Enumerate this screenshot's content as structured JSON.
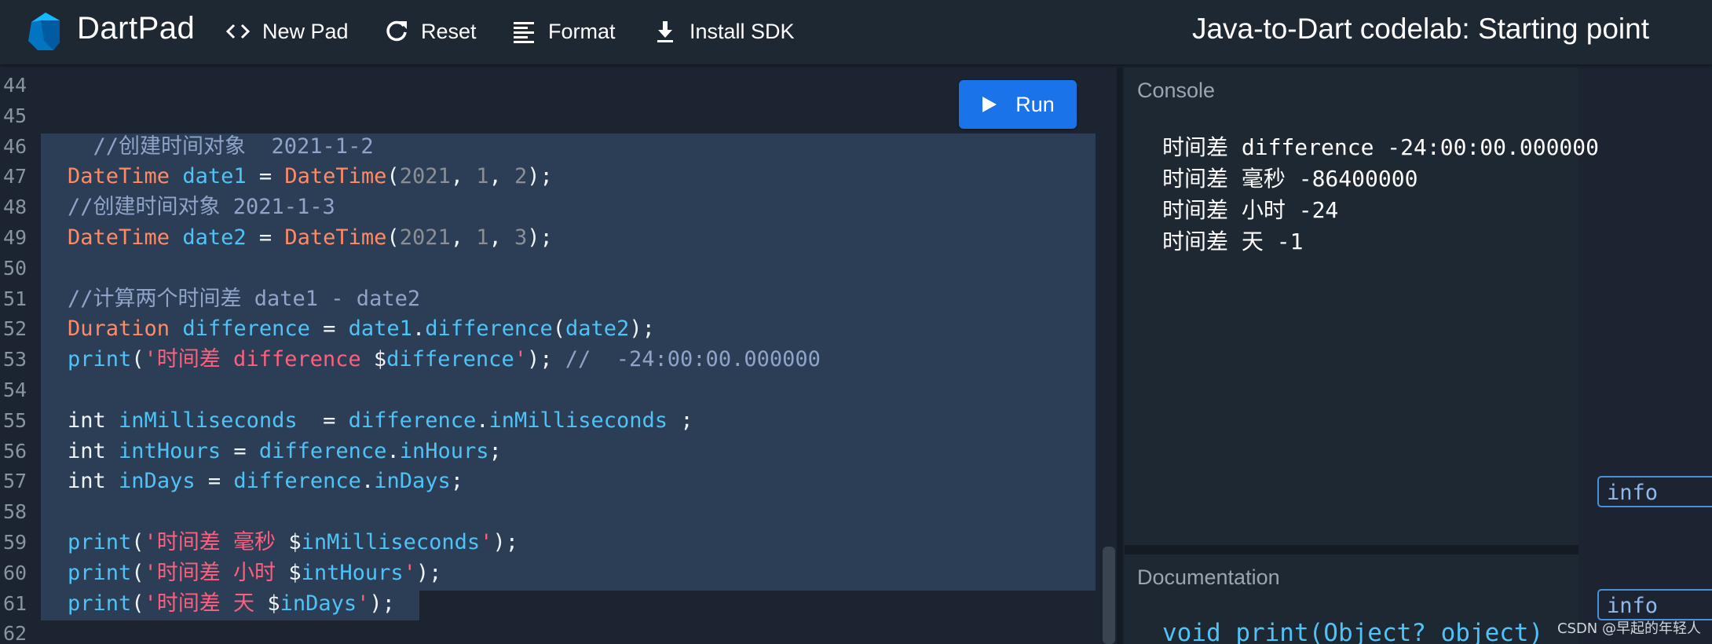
{
  "header": {
    "app_name": "DartPad",
    "new_pad_label": "New Pad",
    "reset_label": "Reset",
    "format_label": "Format",
    "install_sdk_label": "Install SDK",
    "doc_title": "Java-to-Dart codelab: Starting point"
  },
  "editor": {
    "run_label": "Run",
    "line_numbers": [
      "44",
      "45",
      "46",
      "47",
      "48",
      "49",
      "50",
      "51",
      "52",
      "53",
      "54",
      "55",
      "56",
      "57",
      "58",
      "59",
      "60",
      "61",
      "62"
    ],
    "lines": [
      [],
      [],
      [
        {
          "t": "com",
          "v": "  //创建时间对象  2021-1-2"
        }
      ],
      [
        {
          "t": "type",
          "v": "DateTime"
        },
        {
          "t": "plain",
          "v": " "
        },
        {
          "t": "var",
          "v": "date1"
        },
        {
          "t": "plain",
          "v": " = "
        },
        {
          "t": "type",
          "v": "DateTime"
        },
        {
          "t": "plain",
          "v": "("
        },
        {
          "t": "num",
          "v": "2021"
        },
        {
          "t": "plain",
          "v": ", "
        },
        {
          "t": "num",
          "v": "1"
        },
        {
          "t": "plain",
          "v": ", "
        },
        {
          "t": "num",
          "v": "2"
        },
        {
          "t": "plain",
          "v": ");"
        }
      ],
      [
        {
          "t": "com",
          "v": "//创建时间对象 2021-1-3"
        }
      ],
      [
        {
          "t": "type",
          "v": "DateTime"
        },
        {
          "t": "plain",
          "v": " "
        },
        {
          "t": "var",
          "v": "date2"
        },
        {
          "t": "plain",
          "v": " = "
        },
        {
          "t": "type",
          "v": "DateTime"
        },
        {
          "t": "plain",
          "v": "("
        },
        {
          "t": "num",
          "v": "2021"
        },
        {
          "t": "plain",
          "v": ", "
        },
        {
          "t": "num",
          "v": "1"
        },
        {
          "t": "plain",
          "v": ", "
        },
        {
          "t": "num",
          "v": "3"
        },
        {
          "t": "plain",
          "v": ");"
        }
      ],
      [],
      [
        {
          "t": "com",
          "v": "//计算两个时间差 date1 - date2"
        }
      ],
      [
        {
          "t": "type",
          "v": "Duration"
        },
        {
          "t": "plain",
          "v": " "
        },
        {
          "t": "var",
          "v": "difference"
        },
        {
          "t": "plain",
          "v": " = "
        },
        {
          "t": "var",
          "v": "date1"
        },
        {
          "t": "plain",
          "v": "."
        },
        {
          "t": "fn",
          "v": "difference"
        },
        {
          "t": "plain",
          "v": "("
        },
        {
          "t": "var",
          "v": "date2"
        },
        {
          "t": "plain",
          "v": ");"
        }
      ],
      [
        {
          "t": "fn",
          "v": "print"
        },
        {
          "t": "plain",
          "v": "("
        },
        {
          "t": "str",
          "v": "'时间差 difference "
        },
        {
          "t": "plain",
          "v": "$"
        },
        {
          "t": "var",
          "v": "difference"
        },
        {
          "t": "str",
          "v": "'"
        },
        {
          "t": "plain",
          "v": "); "
        },
        {
          "t": "com",
          "v": "//  -24:00:00.000000"
        }
      ],
      [],
      [
        {
          "t": "kw",
          "v": "int"
        },
        {
          "t": "plain",
          "v": " "
        },
        {
          "t": "var",
          "v": "inMilliseconds"
        },
        {
          "t": "plain",
          "v": "  = "
        },
        {
          "t": "var",
          "v": "difference"
        },
        {
          "t": "plain",
          "v": "."
        },
        {
          "t": "var",
          "v": "inMilliseconds"
        },
        {
          "t": "plain",
          "v": " ;"
        }
      ],
      [
        {
          "t": "kw",
          "v": "int"
        },
        {
          "t": "plain",
          "v": " "
        },
        {
          "t": "var",
          "v": "intHours"
        },
        {
          "t": "plain",
          "v": " = "
        },
        {
          "t": "var",
          "v": "difference"
        },
        {
          "t": "plain",
          "v": "."
        },
        {
          "t": "var",
          "v": "inHours"
        },
        {
          "t": "plain",
          "v": ";"
        }
      ],
      [
        {
          "t": "kw",
          "v": "int"
        },
        {
          "t": "plain",
          "v": " "
        },
        {
          "t": "var",
          "v": "inDays"
        },
        {
          "t": "plain",
          "v": " = "
        },
        {
          "t": "var",
          "v": "difference"
        },
        {
          "t": "plain",
          "v": "."
        },
        {
          "t": "var",
          "v": "inDays"
        },
        {
          "t": "plain",
          "v": ";"
        }
      ],
      [],
      [
        {
          "t": "fn",
          "v": "print"
        },
        {
          "t": "plain",
          "v": "("
        },
        {
          "t": "str",
          "v": "'时间差 毫秒 "
        },
        {
          "t": "plain",
          "v": "$"
        },
        {
          "t": "var",
          "v": "inMilliseconds"
        },
        {
          "t": "str",
          "v": "'"
        },
        {
          "t": "plain",
          "v": ");"
        }
      ],
      [
        {
          "t": "fn",
          "v": "print"
        },
        {
          "t": "plain",
          "v": "("
        },
        {
          "t": "str",
          "v": "'时间差 小时 "
        },
        {
          "t": "plain",
          "v": "$"
        },
        {
          "t": "var",
          "v": "intHours"
        },
        {
          "t": "str",
          "v": "'"
        },
        {
          "t": "plain",
          "v": ");"
        }
      ],
      [
        {
          "t": "fn",
          "v": "print"
        },
        {
          "t": "plain",
          "v": "("
        },
        {
          "t": "str",
          "v": "'时间差 天 "
        },
        {
          "t": "plain",
          "v": "$"
        },
        {
          "t": "var",
          "v": "inDays"
        },
        {
          "t": "str",
          "v": "'"
        },
        {
          "t": "plain",
          "v": ");"
        }
      ],
      []
    ]
  },
  "console": {
    "title": "Console",
    "lines": [
      "时间差 difference -24:00:00.000000",
      "时间差 毫秒 -86400000",
      "时间差 小时 -24",
      "时间差 天 -1"
    ]
  },
  "documentation": {
    "title": "Documentation",
    "signature": "void print(Object? object)"
  },
  "issues": {
    "badges": [
      "info",
      "info"
    ]
  },
  "watermark": "CSDN @早起的年轻人",
  "colors": {
    "accent": "#1a73e8",
    "type": "#ff8a65",
    "identifier": "#4fc3f7",
    "string": "#ff5f7e",
    "comment": "#8fa4c8",
    "number": "#8b8f94",
    "selection": "#2b3e55"
  },
  "icons": {
    "logo": "dart-logo-icon",
    "new_pad": "code-brackets-icon",
    "reset": "refresh-icon",
    "format": "format-lines-icon",
    "install": "download-icon",
    "run": "play-icon"
  }
}
